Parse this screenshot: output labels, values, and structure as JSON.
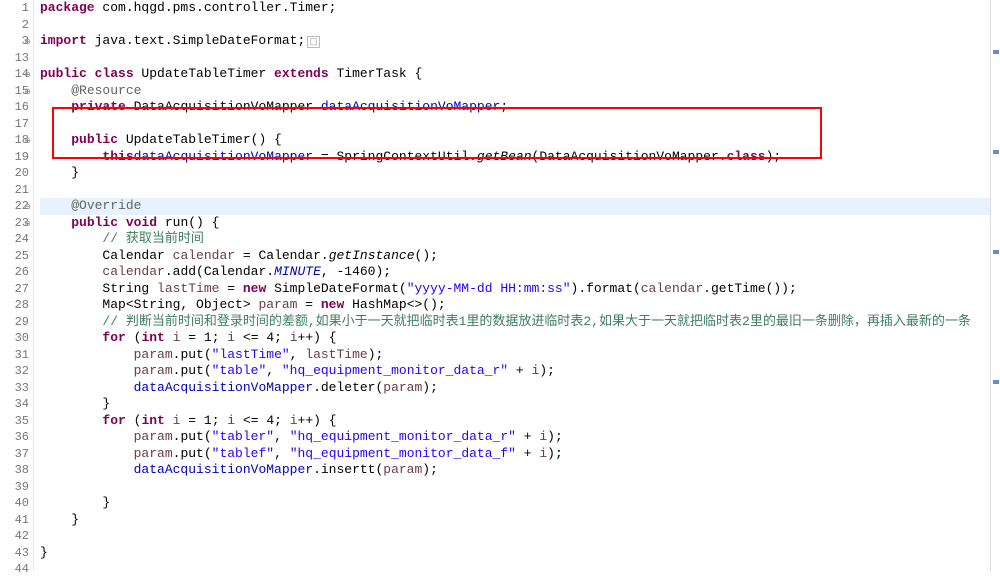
{
  "gutter": [
    "1",
    "2",
    "3",
    "13",
    "14",
    "15",
    "16",
    "17",
    "18",
    "19",
    "20",
    "21",
    "22",
    "23",
    "24",
    "25",
    "26",
    "27",
    "28",
    "29",
    "30",
    "31",
    "32",
    "33",
    "34",
    "35",
    "36",
    "37",
    "38",
    "39",
    "40",
    "41",
    "42",
    "43",
    "44"
  ],
  "folds": {
    "2": "⊕",
    "4": "⊖",
    "5": "⊖",
    "8": "⊖",
    "12": "⊖",
    "13": "⊖"
  },
  "lines": {
    "l1": {
      "pkg": "package ",
      "name": "com.hqgd.pms.controller.Timer;"
    },
    "l3": {
      "imp": "import ",
      "name": "java.text.SimpleDateFormat;",
      "box": "▢"
    },
    "l14": {
      "p": "public class ",
      "cls": "UpdateTableTimer ",
      "ext": "extends ",
      "sup": "TimerTask {"
    },
    "l15": {
      "ann": "@Resource"
    },
    "l16": {
      "p": "private ",
      "t": "DataAcquisitionVoMapper ",
      "f": "dataAcquisitionVoMapper",
      ";": ";"
    },
    "l18": {
      "p": "public ",
      "m": "UpdateTableTimer() {"
    },
    "l19": {
      "a": "this",
      ".": ".",
      "f": "dataAcquisitionVoMapper",
      "eq": " = SpringContextUtil.",
      "m": "getBean",
      "open": "(DataAcquisitionVoMapper.",
      "cls": "class",
      "close": ");"
    },
    "l20": "}",
    "l22": {
      "ann": "@Override"
    },
    "l23": {
      "p": "public void ",
      "m": "run() {"
    },
    "l24": {
      "cmt": "// 获取当前时间"
    },
    "l25": {
      "a": "Calendar ",
      "v": "calendar",
      "b": " = Calendar.",
      "m": "getInstance",
      "c": "();"
    },
    "l26": {
      "v": "calendar",
      "a": ".add(Calendar.",
      "s": "MINUTE",
      "b": ", -1460);"
    },
    "l27": {
      "a": "String ",
      "v": "lastTime",
      "b": " = ",
      "kw": "new ",
      "c": "SimpleDateFormat(",
      "str": "\"yyyy-MM-dd HH:mm:ss\"",
      "d": ").format(",
      "v2": "calendar",
      "e": ".getTime());"
    },
    "l28": {
      "a": "Map<String, Object> ",
      "v": "param",
      "b": " = ",
      "kw": "new ",
      "c": "HashMap<>();"
    },
    "l29": {
      "cmt": "// 判断当前时间和登录时间的差额,如果小于一天就把临时表1里的数据放进临时表2,如果大于一天就把临时表2里的最旧一条删除，再插入最新的一条"
    },
    "l30": {
      "kw": "for ",
      "a": "(",
      "kw2": "int ",
      "v": "i",
      "b": " = 1; ",
      "v2": "i",
      "c": " <= 4; ",
      "v3": "i",
      "d": "++) {"
    },
    "l31": {
      "v": "param",
      "a": ".put(",
      "s1": "\"lastTime\"",
      "b": ", ",
      "v2": "lastTime",
      "c": ");"
    },
    "l32": {
      "v": "param",
      "a": ".put(",
      "s1": "\"table\"",
      "b": ", ",
      "s2": "\"hq_equipment_monitor_data_r\"",
      "c": " + ",
      "v2": "i",
      "d": ");"
    },
    "l33": {
      "f": "dataAcquisitionVoMapper",
      "a": ".deleter(",
      "v": "param",
      "b": ");"
    },
    "l34": "}",
    "l35": {
      "kw": "for ",
      "a": "(",
      "kw2": "int ",
      "v": "i",
      "b": " = 1; ",
      "v2": "i",
      "c": " <= 4; ",
      "v3": "i",
      "d": "++) {"
    },
    "l36": {
      "v": "param",
      "a": ".put(",
      "s1": "\"tabler\"",
      "b": ", ",
      "s2": "\"hq_equipment_monitor_data_r\"",
      "c": " + ",
      "v2": "i",
      "d": ");"
    },
    "l37": {
      "v": "param",
      "a": ".put(",
      "s1": "\"tablef\"",
      "b": ", ",
      "s2": "\"hq_equipment_monitor_data_f\"",
      "c": " + ",
      "v2": "i",
      "d": ");"
    },
    "l38": {
      "f": "dataAcquisitionVoMapper",
      "a": ".insertt(",
      "v": "param",
      "b": ");"
    },
    "l40": "}",
    "l41": "}",
    "l43": "}"
  },
  "indent": {
    "i1": "    ",
    "i2": "        ",
    "i3": "            ",
    "i4": "                "
  }
}
